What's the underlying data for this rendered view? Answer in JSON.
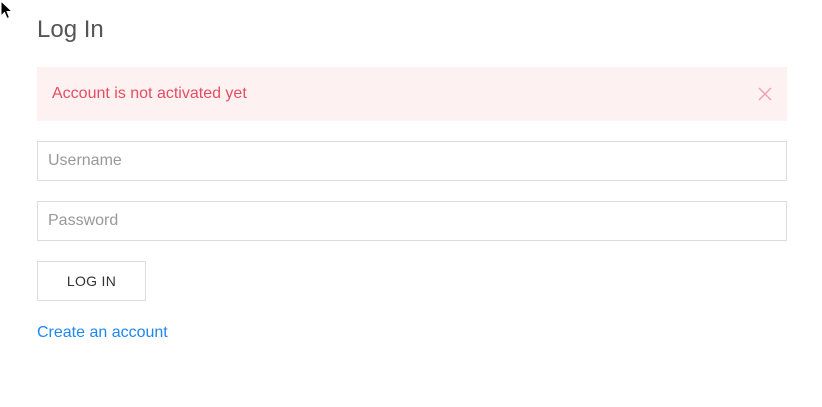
{
  "login": {
    "title": "Log In",
    "alert": {
      "message": "Account is not activated yet",
      "close_icon": "close-icon"
    },
    "username": {
      "placeholder": "Username",
      "value": ""
    },
    "password": {
      "placeholder": "Password",
      "value": ""
    },
    "submit_label": "LOG IN",
    "create_account_label": "Create an account"
  },
  "colors": {
    "title": "#555555",
    "alert_background": "#fef1f2",
    "alert_text": "#e44e62",
    "border": "#dcdcdc",
    "link": "#1e87f0"
  },
  "icons": {
    "cursor": "mouse-pointer-icon",
    "alert_close": "close-icon"
  }
}
